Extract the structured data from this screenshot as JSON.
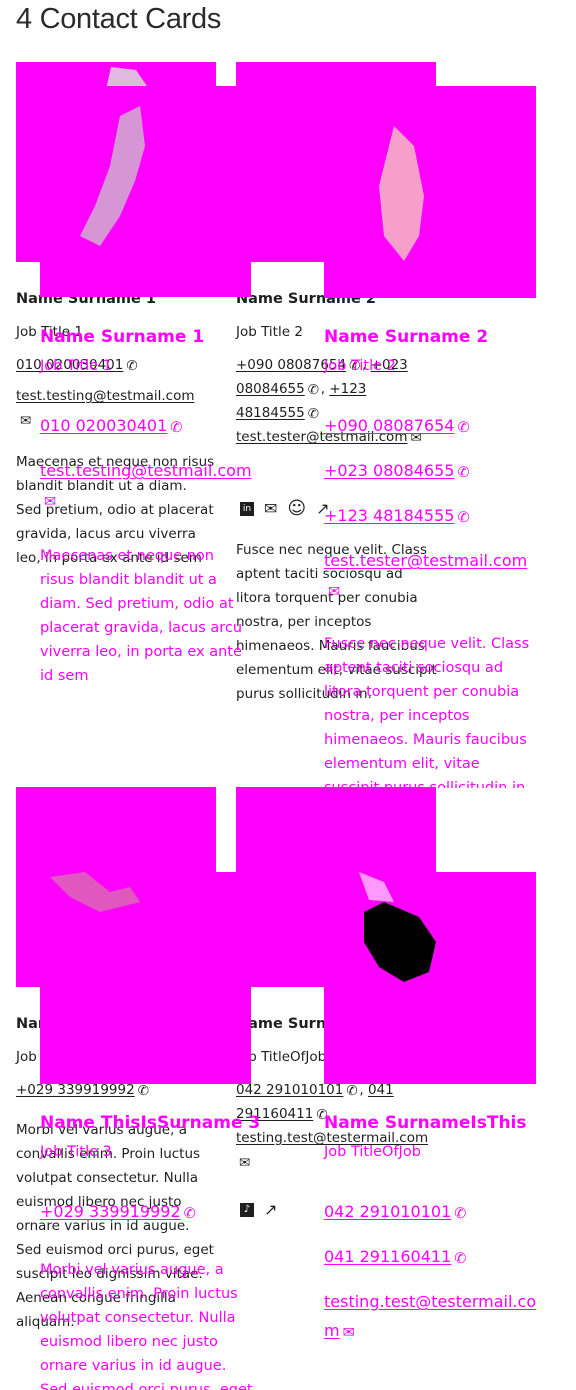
{
  "page": {
    "title": "4 Contact Cards"
  },
  "cards": [
    {
      "name": "Name Surname 1",
      "job": "Job Title 1",
      "phones": [
        "010 020030401"
      ],
      "email": "test.testing@testmail.com",
      "description": "Maecenas et neque non risus blandit blandit ut a diam. Sed pretium, odio at placerat gravida, lacus arcu viverra leo, in porta ex ante id sem"
    },
    {
      "name": "Name Surname 2",
      "job": "Job Title 2",
      "phones": [
        "+090 08087654",
        "+023 08084655",
        "+123 48184555"
      ],
      "email": "test.tester@testmail.com",
      "description": "Fusce nec neque velit. Class aptent taciti sociosqu ad litora torquent per conubia nostra, per inceptos himenaeos. Mauris faucibus elementum elit, vitae suscipit purus sollicitudin in."
    },
    {
      "name": "Name ThisIsSurname 3",
      "job": "Job Title 3",
      "phones": [
        "+029 339919992"
      ],
      "email": "",
      "description": "Morbi vel varius augue, a convallis enim. Proin luctus volutpat consectetur. Nulla euismod libero nec justo ornare varius in id augue. Sed euismod orci purus, eget suscipit leo dignissim vitae. Aenean congue fringilla aliquam."
    },
    {
      "name": "Name SurnameIsThis",
      "job": "Job TitleOfJob",
      "phones": [
        "042 291010101",
        "041 291160411"
      ],
      "email": "testing.test@testermail.com",
      "description": ""
    }
  ],
  "colors": {
    "placeholder": "#ff00ff",
    "text": "#1f1f1f"
  },
  "icons": [
    "phone-icon",
    "mail-icon",
    "linkedin-icon",
    "smile-icon",
    "tiktok-icon",
    "external-link-icon"
  ]
}
